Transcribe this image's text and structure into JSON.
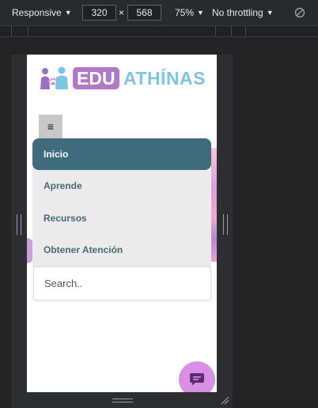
{
  "devtools": {
    "device_mode": "Responsive",
    "width": "320",
    "height": "568",
    "times_sign": "×",
    "zoom": "75%",
    "throttling": "No throttling",
    "caret": "▼"
  },
  "site": {
    "logo_edu": "EDU",
    "logo_athinas": "ATHÍNAS",
    "menu_toggle": "≡",
    "nav": {
      "items": [
        {
          "label": "Inicio"
        },
        {
          "label": "Aprende"
        },
        {
          "label": "Recursos"
        },
        {
          "label": "Obtener Atención"
        }
      ]
    },
    "search": {
      "placeholder": "Search.."
    }
  },
  "colors": {
    "nav_active_bg": "#3e6c7c",
    "nav_bg": "#ebebeb",
    "nav_text": "#466a78",
    "logo_edu_bg": "#b178c8",
    "logo_athinas": "#7cc6e4",
    "chat_fab": "#d98fe6"
  },
  "icons": {
    "chat_fab": "chat-bubble-icon",
    "rotate": "rotate-disabled-icon",
    "resize": "resize-grip-icon"
  }
}
